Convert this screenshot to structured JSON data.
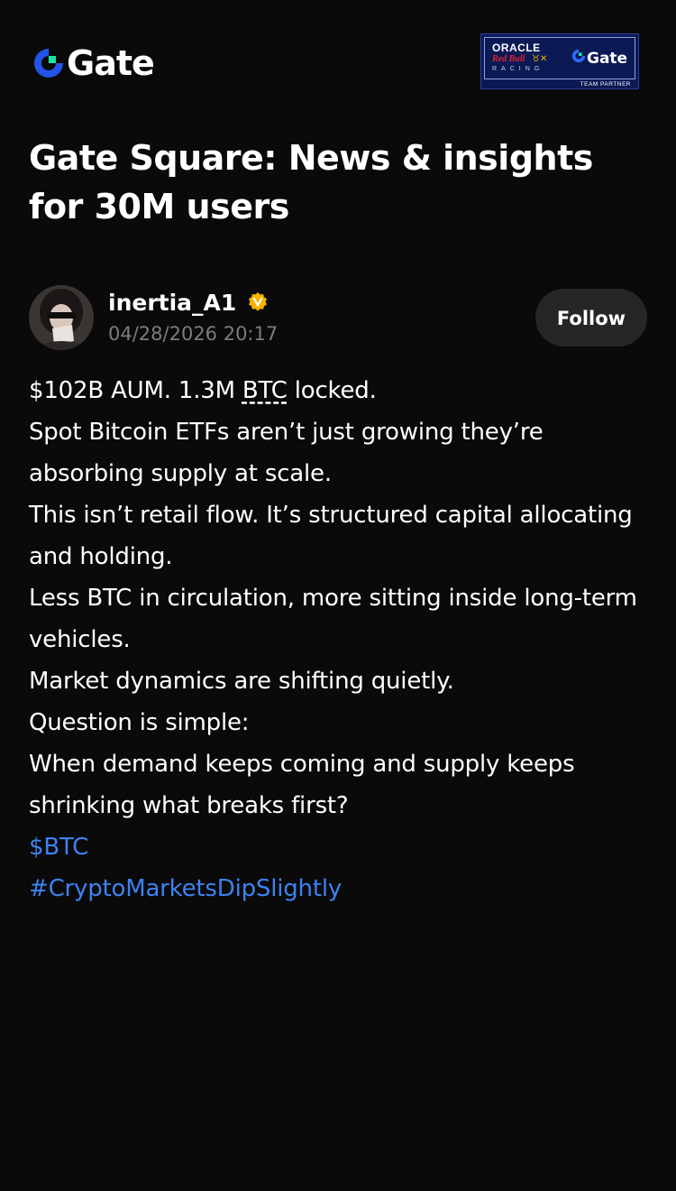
{
  "header": {
    "logo_text": "Gate",
    "partner": {
      "oracle": "ORACLE",
      "redbull": "Red Bull",
      "racing": "RACING",
      "gate": "Gate",
      "team_partner": "TEAM PARTNER"
    }
  },
  "page": {
    "title": "Gate Square: News & insights for 30M users"
  },
  "post": {
    "author": {
      "name": "inertia_A1",
      "timestamp": "04/28/2026 20:17"
    },
    "follow_label": "Follow",
    "lines": {
      "l1_before": "$102B AUM. 1.3M ",
      "l1_term": "BTC",
      "l1_after": " locked.",
      "l2": "Spot Bitcoin ETFs aren’t just growing  they’re absorbing supply at scale.",
      "l3": "This isn’t retail flow. It’s structured capital allocating and holding.",
      "l4": "Less BTC in circulation, more sitting inside long-term vehicles.",
      "l5": "Market dynamics are shifting quietly.",
      "l6": "Question is simple:",
      "l7": "When demand keeps coming and supply keeps shrinking what breaks first?"
    },
    "cashtag": "$BTC",
    "hashtag": "#CryptoMarketsDipSlightly"
  },
  "colors": {
    "background": "#0a0a0a",
    "link": "#3d82f0",
    "muted_text": "#7c7c7c",
    "button_bg": "#262626",
    "verified_badge": "#f5b400",
    "brand_blue": "#2354e6",
    "brand_green": "#17e6a1"
  },
  "icons": {
    "logo": "gate-logo-icon",
    "verified": "verified-badge-icon"
  }
}
